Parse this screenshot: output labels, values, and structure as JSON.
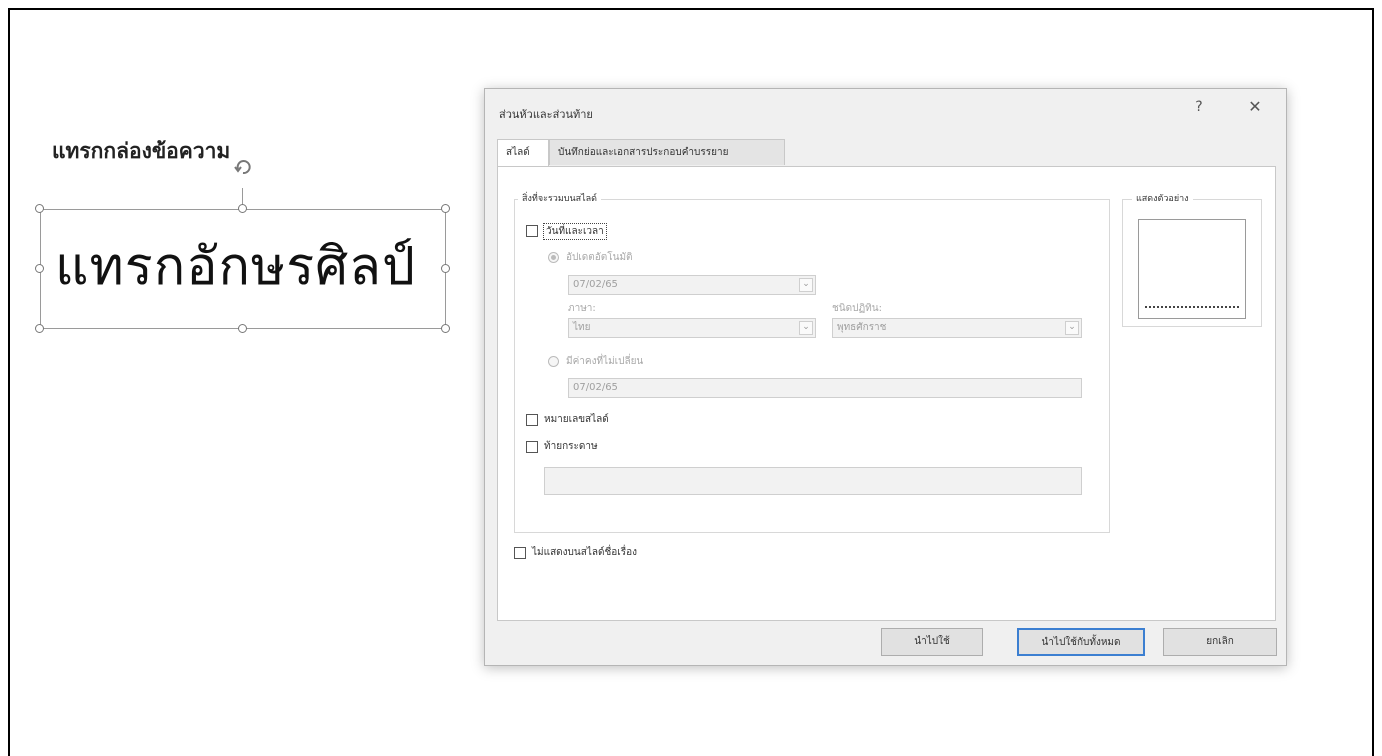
{
  "slide": {
    "caption": "แทรกกล่องข้อความ",
    "wordart_text": "แทรกอักษรศิลป์"
  },
  "dialog": {
    "title": "ส่วนหัวและส่วนท้าย",
    "help": "?",
    "close": "✕",
    "tabs": [
      {
        "label": "สไลด์",
        "active": true
      },
      {
        "label": "บันทึกย่อและเอกสารประกอบคำบรรยาย",
        "active": false
      }
    ],
    "include_group_label": "สิ่งที่จะรวมบนสไลด์",
    "date_time": {
      "label": "วันที่และเวลา",
      "checked": false,
      "auto_update_label": "อัปเดตอัตโนมัติ",
      "auto_value": "07/02/65",
      "language_label": "ภาษา:",
      "language_value": "ไทย",
      "calendar_label": "ชนิดปฏิทิน:",
      "calendar_value": "พุทธศักราช",
      "fixed_label": "มีค่าคงที่ไม่เปลี่ยน",
      "fixed_value": "07/02/65"
    },
    "slide_number": {
      "label": "หมายเลขสไลด์",
      "checked": false
    },
    "footer": {
      "label": "ท้ายกระดาษ",
      "checked": false,
      "value": ""
    },
    "dont_show_title": {
      "label": "ไม่แสดงบนสไลด์ชื่อเรื่อง",
      "checked": false
    },
    "preview_label": "แสดงตัวอย่าง",
    "buttons": {
      "apply": "นำไปใช้",
      "apply_all": "นำไปใช้กับทั้งหมด",
      "cancel": "ยกเลิก"
    }
  }
}
